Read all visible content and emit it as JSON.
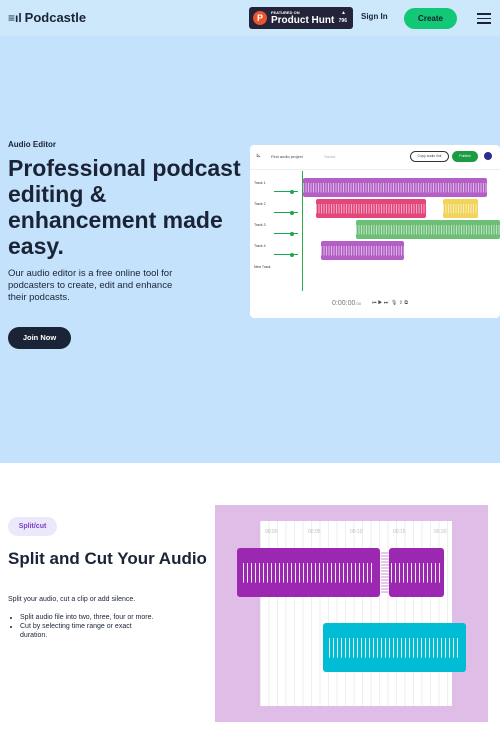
{
  "nav": {
    "logo": "Podcastle",
    "ph_featured": "FEATURED ON",
    "ph_name": "Product Hunt",
    "ph_votes": "796",
    "sign_in": "Sign In",
    "create": "Create"
  },
  "hero": {
    "kicker": "Audio Editor",
    "title": "Professional podcast editing & enhancement made easy.",
    "subtitle": "Our audio editor is a free online tool for podcasters to create, edit and enhance their podcasts.",
    "cta": "Join Now"
  },
  "editor": {
    "project": "First audio project",
    "saved": "Saved",
    "copy_link": "Copy audio link",
    "publish": "Publish",
    "tracks": [
      "Track 1",
      "Track 2",
      "Track 3",
      "Track 4"
    ],
    "new_track": "New Track",
    "time": "0:00:00",
    "time_ms": ".00",
    "colors": {
      "t1": "#b35fc6",
      "t2": "#e4457a",
      "t2b": "#f2d45a",
      "t3": "#6dbf78",
      "t4": "#b35fc6"
    }
  },
  "feature": {
    "tag": "Split/cut",
    "title": "Split and Cut Your Audio",
    "desc": "Split your audio, cut a clip or add silence.",
    "bullets": [
      "Split audio file into two, three, four or more.",
      "Cut by selecting time range or exact duration."
    ],
    "timeline": [
      "00:00",
      "00:05",
      "00:10",
      "00:15",
      "00:20"
    ],
    "colors": {
      "clip_a": "#9c27b0",
      "clip_b": "#00bcd4",
      "bg": "#e0bde6"
    }
  }
}
